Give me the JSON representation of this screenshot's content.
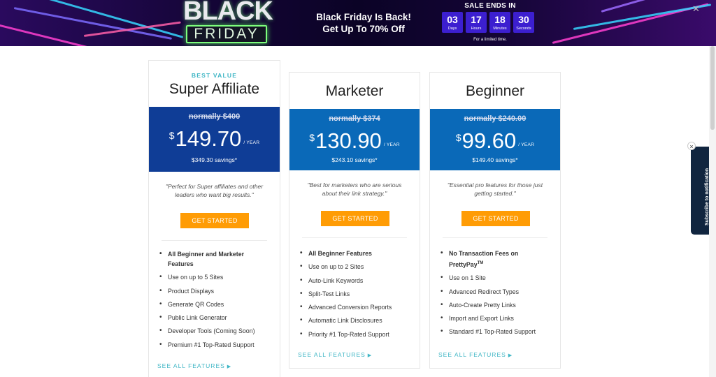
{
  "banner": {
    "logo_top": "BLACK",
    "logo_bottom": "FRIDAY",
    "headline_1": "Black Friday Is Back!",
    "headline_2": "Get Up To 70% Off",
    "sale_title": "SALE ENDS IN",
    "timer": [
      {
        "value": "03",
        "label": "Days"
      },
      {
        "value": "17",
        "label": "Hours"
      },
      {
        "value": "18",
        "label": "Minutes"
      },
      {
        "value": "30",
        "label": "Seconds"
      }
    ],
    "limited": "For a limited time.",
    "close_icon": "close-icon"
  },
  "plans": [
    {
      "badge": "BEST VALUE",
      "name": "Super Affiliate",
      "normally": "normally $400",
      "currency": "$",
      "amount": "149.70",
      "period": "/ YEAR",
      "savings": "$349.30 savings*",
      "description": "\"Perfect for Super affiliates and other leaders who want big results.\"",
      "cta": "GET STARTED",
      "features": [
        "All Beginner and Marketer Features",
        "Use on up to 5 Sites",
        "Product Displays",
        "Generate QR Codes",
        "Public Link Generator",
        "Developer Tools (Coming Soon)",
        "Premium #1 Top-Rated Support"
      ],
      "see_all": "SEE ALL FEATURES"
    },
    {
      "name": "Marketer",
      "normally": "normally $374",
      "currency": "$",
      "amount": "130.90",
      "period": "/ YEAR",
      "savings": "$243.10 savings*",
      "description": "\"Best for marketers who are serious about their link strategy.\"",
      "cta": "GET STARTED",
      "features": [
        "All Beginner Features",
        "Use on up to 2 Sites",
        "Auto-Link Keywords",
        "Split-Test Links",
        "Advanced Conversion Reports",
        "Automatic Link Disclosures",
        "Priority #1 Top-Rated Support"
      ],
      "see_all": "SEE ALL FEATURES"
    },
    {
      "name": "Beginner",
      "normally": "normally $240.00",
      "currency": "$",
      "amount": "99.60",
      "period": "/ YEAR",
      "savings": "$149.40 savings*",
      "description": "\"Essential pro features for those just getting started.\"",
      "cta": "GET STARTED",
      "features": [
        "No Transaction Fees on PrettyPay",
        "Use on 1 Site",
        "Advanced Redirect Types",
        "Auto-Create Pretty Links",
        "Import and Export Links",
        "Standard #1 Top-Rated Support"
      ],
      "feature_0_tm": "TM",
      "see_all": "SEE ALL FEATURES"
    }
  ],
  "subscribe": {
    "label": "Subscribe to notification",
    "close": "×"
  },
  "colors": {
    "accent_teal": "#3fb6c5",
    "cta_orange": "#ff9c05",
    "super_blue": "#0f3d96",
    "plan_blue": "#0a69b8",
    "timer_purple": "#3c1fd0"
  }
}
